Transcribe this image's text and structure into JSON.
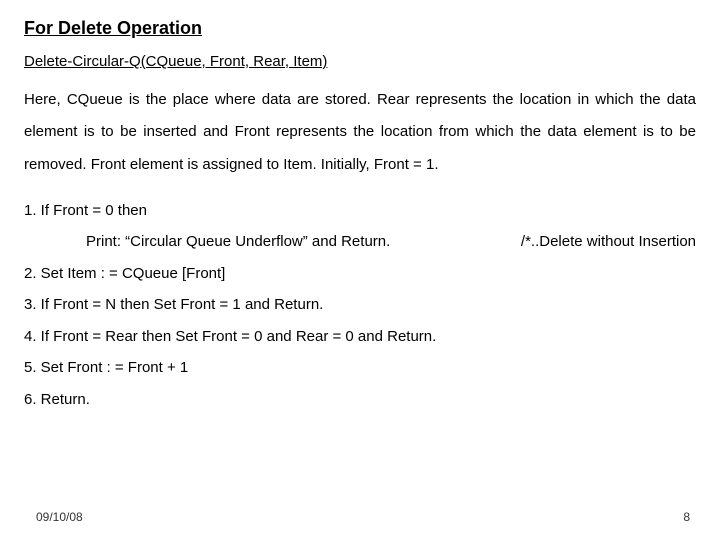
{
  "title": "For Delete Operation",
  "subtitle": "Delete-Circular-Q(CQueue, Front, Rear, Item)",
  "paragraph": "Here, CQueue is the place where data are stored. Rear represents the location in which the data element is to be inserted and Front represents the location from which the data element is to be removed. Front element is assigned to Item. Initially, Front = 1.",
  "steps": {
    "s1": "1. If Front = 0 then",
    "s1a": "Print: “Circular Queue Underflow” and Return.",
    "s1a_comment": "/*..Delete without Insertion",
    "s2": "2. Set Item : = CQueue [Front]",
    "s3": "3. If Front = N then Set Front = 1 and Return.",
    "s4": "4. If Front = Rear then Set Front = 0 and Rear = 0 and Return.",
    "s5": "5. Set Front : = Front + 1",
    "s6": "6. Return."
  },
  "footer": {
    "date": "09/10/08",
    "page": "8"
  }
}
